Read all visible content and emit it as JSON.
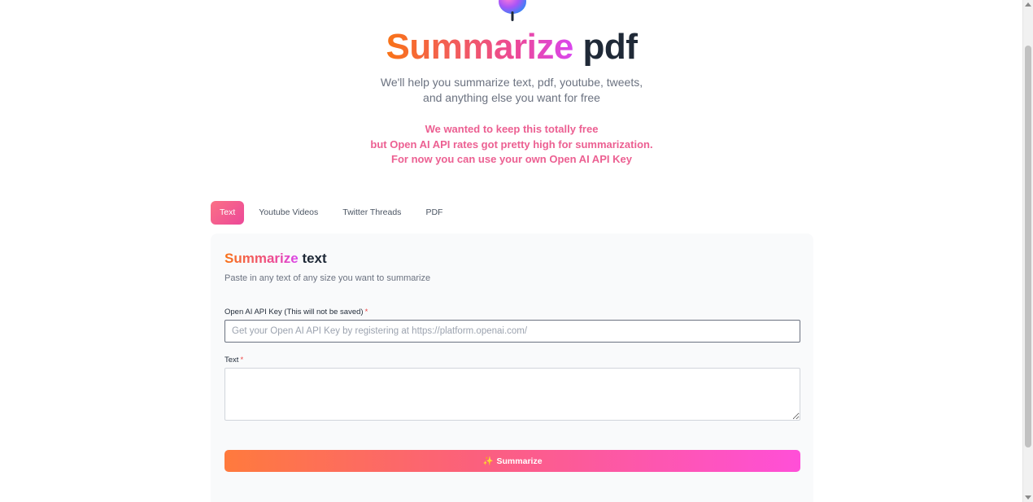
{
  "header": {
    "title_highlight": "Summarize",
    "title_rest": "pdf",
    "subtitle_line1": "We'll help you summarize text, pdf, youtube, tweets,",
    "subtitle_line2": "and anything else you want for free",
    "notice_line1": "We wanted to keep this totally free",
    "notice_line2": "but Open AI API rates got pretty high for summarization.",
    "notice_line3": "For now you can use your own Open AI API Key"
  },
  "tabs": [
    {
      "label": "Text",
      "active": true
    },
    {
      "label": "Youtube Videos",
      "active": false
    },
    {
      "label": "Twitter Threads",
      "active": false
    },
    {
      "label": "PDF",
      "active": false
    }
  ],
  "card": {
    "title_highlight": "Summarize",
    "title_rest": "text",
    "description": "Paste in any text of any size you want to summarize",
    "api_key_label": "Open AI API Key (This will not be saved)",
    "api_key_required": "*",
    "api_key_placeholder": "Get your Open AI API Key by registering at https://platform.openai.com/",
    "api_key_value": "",
    "text_label": "Text",
    "text_required": "*",
    "text_value": "",
    "button_icon": "✨",
    "button_label": "Summarize"
  },
  "colors": {
    "accent_orange": "#f97316",
    "accent_pink": "#ec4899",
    "accent_magenta": "#d946ef",
    "notice_pink": "#ec6092"
  },
  "icons": {
    "logo": "balloon-logo-icon",
    "button": "sparkles-icon"
  }
}
